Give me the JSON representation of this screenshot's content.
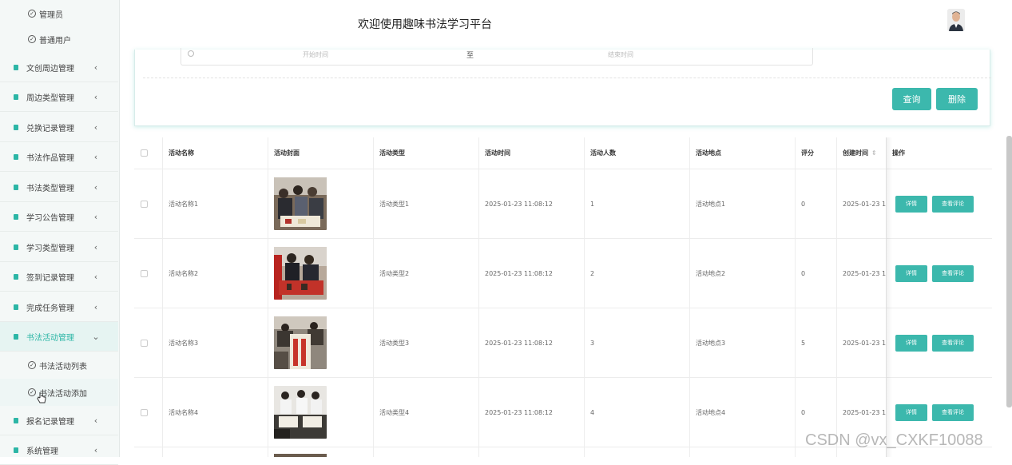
{
  "header": {
    "title": "欢迎使用趣味书法学习平台"
  },
  "sidebar": {
    "top_subitems": [
      {
        "label": "管理员"
      },
      {
        "label": "普通用户"
      }
    ],
    "items": [
      {
        "label": "文创周边管理"
      },
      {
        "label": "周边类型管理"
      },
      {
        "label": "兑换记录管理"
      },
      {
        "label": "书法作品管理"
      },
      {
        "label": "书法类型管理"
      },
      {
        "label": "学习公告管理"
      },
      {
        "label": "学习类型管理"
      },
      {
        "label": "签到记录管理"
      },
      {
        "label": "完成任务管理"
      },
      {
        "label": "书法活动管理"
      },
      {
        "label": "报名记录管理"
      },
      {
        "label": "系统管理"
      }
    ],
    "active_subitems": [
      {
        "label": "书法活动列表"
      },
      {
        "label": "书法活动添加"
      }
    ]
  },
  "search": {
    "start_placeholder": "开始时间",
    "separator": "至",
    "end_placeholder": "结束时间",
    "query_label": "查询",
    "delete_label": "删除"
  },
  "table": {
    "columns": [
      "活动名称",
      "活动封面",
      "活动类型",
      "活动时间",
      "活动人数",
      "活动地点",
      "评分",
      "创建时间",
      "操作"
    ],
    "rows": [
      {
        "name": "活动名称1",
        "type": "活动类型1",
        "time": "2025-01-23 11:08:12",
        "count": "1",
        "place": "活动地点1",
        "score": "0",
        "created": "2025-01-23 1"
      },
      {
        "name": "活动名称2",
        "type": "活动类型2",
        "time": "2025-01-23 11:08:12",
        "count": "2",
        "place": "活动地点2",
        "score": "0",
        "created": "2025-01-23 1"
      },
      {
        "name": "活动名称3",
        "type": "活动类型3",
        "time": "2025-01-23 11:08:12",
        "count": "3",
        "place": "活动地点3",
        "score": "5",
        "created": "2025-01-23 1"
      },
      {
        "name": "活动名称4",
        "type": "活动类型4",
        "time": "2025-01-23 11:08:12",
        "count": "4",
        "place": "活动地点4",
        "score": "0",
        "created": "2025-01-23 1"
      }
    ],
    "detail_label": "详情",
    "comments_label": "查看评论"
  },
  "watermark": "CSDN @vx_CXKF10088",
  "colors": {
    "accent": "#3cb8ad",
    "sidebar_bg": "#f4f8f7"
  }
}
